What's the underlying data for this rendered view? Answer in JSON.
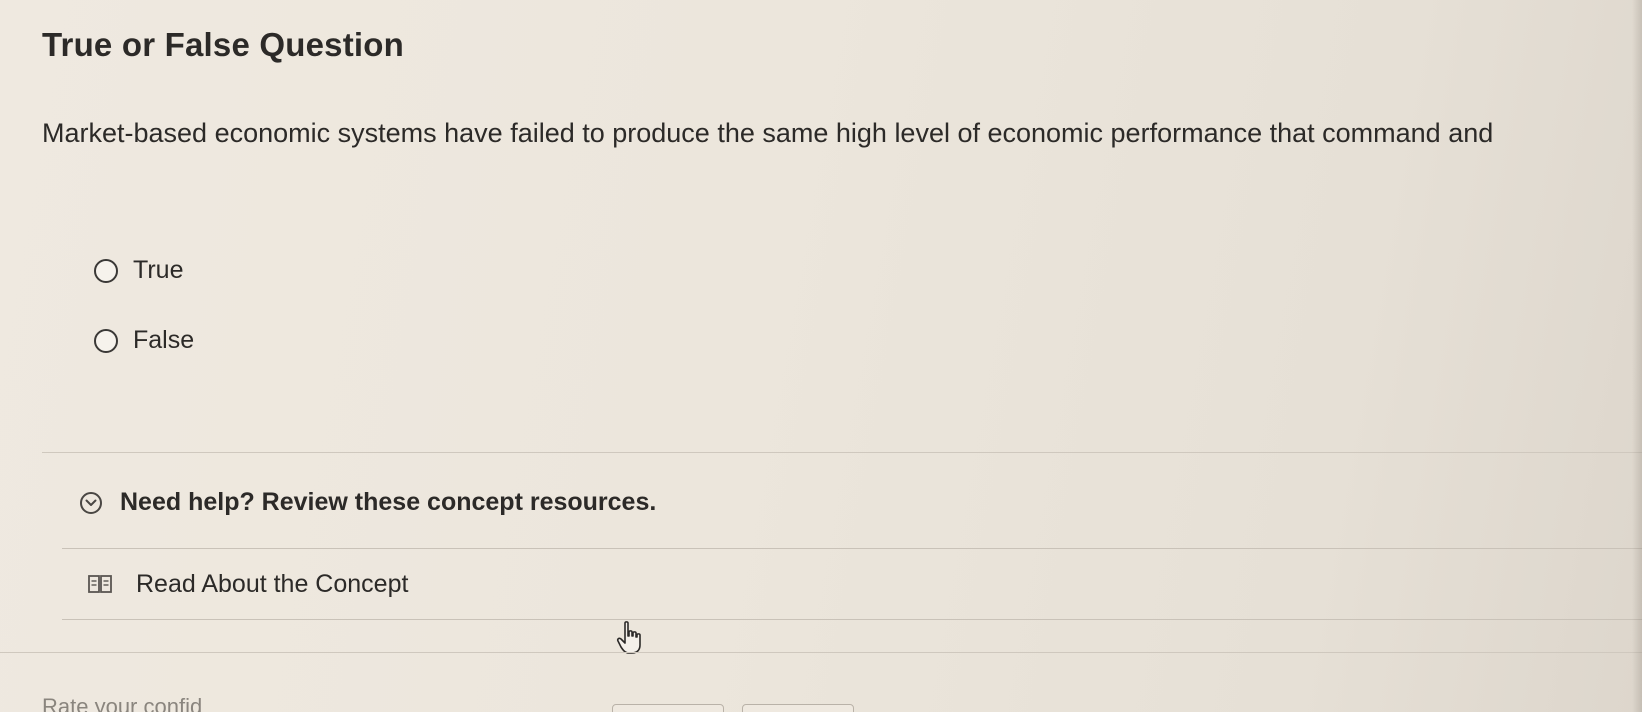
{
  "question": {
    "title": "True or False Question",
    "prompt": "Market-based economic systems have failed to produce the same high level of economic performance that command and",
    "options": [
      {
        "label": "True"
      },
      {
        "label": "False"
      }
    ]
  },
  "help": {
    "toggle_label": "Need help? Review these concept resources.",
    "toggle_icon": "chevron-down-circle-icon",
    "resources": [
      {
        "label": "Read About the Concept",
        "icon": "book-icon"
      }
    ]
  },
  "footer": {
    "rate_prompt": "Rate your confid"
  }
}
